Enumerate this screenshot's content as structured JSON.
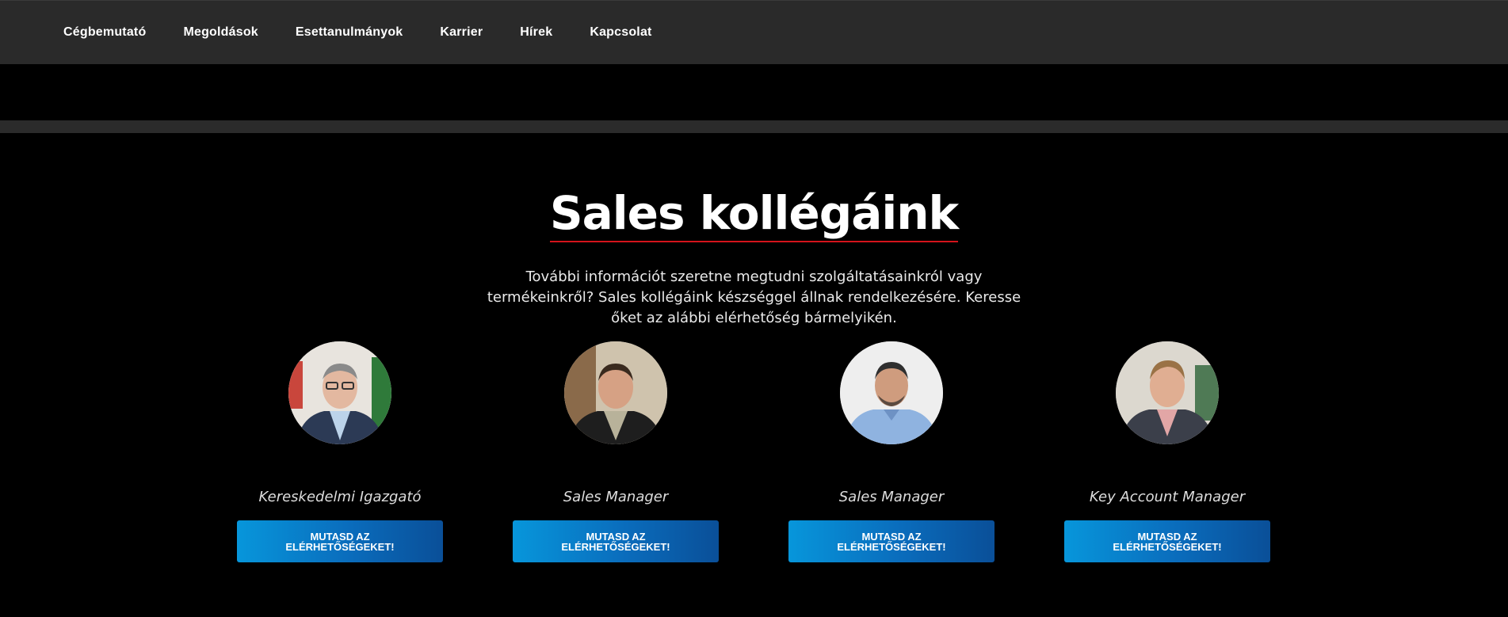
{
  "nav": {
    "items": [
      "Cégbemutató",
      "Megoldások",
      "Esettanulmányok",
      "Karrier",
      "Hírek",
      "Kapcsolat"
    ]
  },
  "section": {
    "title": "Sales kollégáink",
    "intro": "További információt szeretne megtudni szolgáltatásainkról vagy termékeinkről? Sales kollégáink készséggel állnak rendelkezésére. Keresse őket az alábbi elérhetőség bármelyikén."
  },
  "colors": {
    "nav_bg": "#2a2a2a",
    "page_bg": "#000000",
    "title_underline": "#d4131b",
    "button_gradient_start": "#0796db",
    "button_gradient_end": "#0a4f98"
  },
  "team": [
    {
      "role": "Kereskedelmi Igazgató",
      "button": "MUTASD AZ ELÉRHETŐSÉGEKET!"
    },
    {
      "role": "Sales Manager",
      "button": "MUTASD AZ ELÉRHETŐSÉGEKET!"
    },
    {
      "role": "Sales Manager",
      "button": "MUTASD AZ ELÉRHETŐSÉGEKET!"
    },
    {
      "role": "Key Account Manager",
      "button": "MUTASD AZ ELÉRHETŐSÉGEKET!"
    }
  ]
}
